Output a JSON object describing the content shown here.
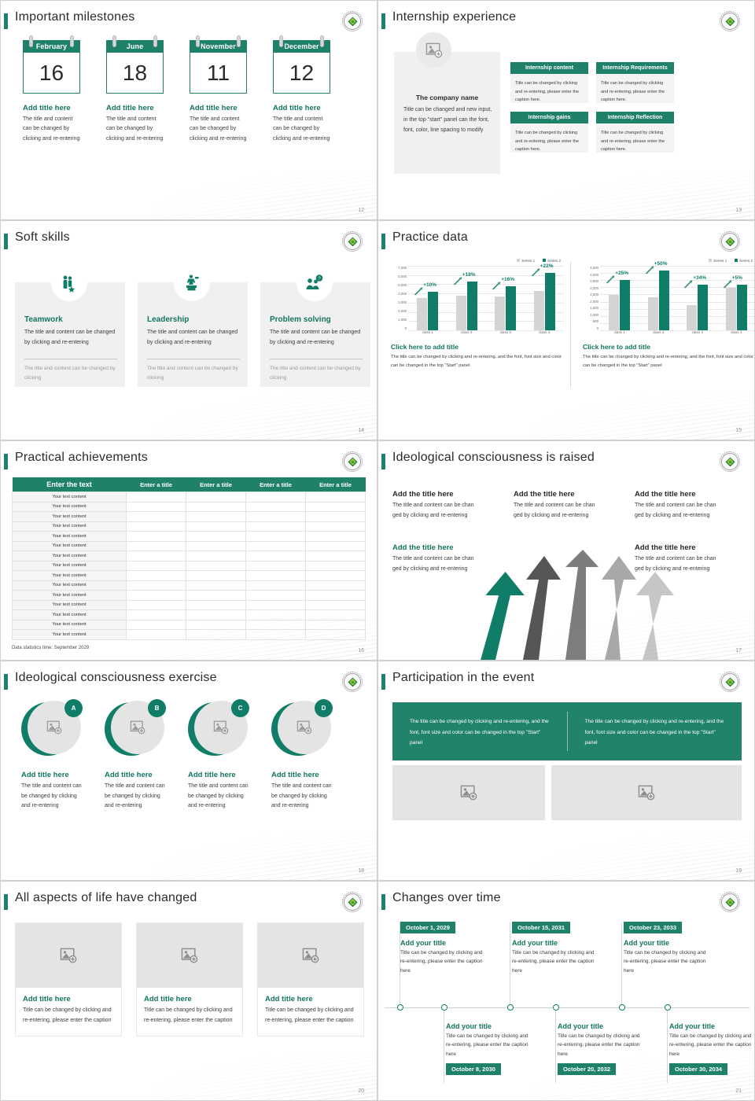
{
  "theme": {
    "green": "#1f8169",
    "green_dark": "#0f7d67",
    "green_text": "#13755f",
    "gray": "#d4d4d4"
  },
  "slides": [
    {
      "id": "important-milestones",
      "title": "Important milestones",
      "page": "12",
      "items": [
        {
          "month": "February",
          "day": "16",
          "title": "Add title here",
          "text": "The title and content can be changed by clicking and re-entering"
        },
        {
          "month": "June",
          "day": "18",
          "title": "Add title here",
          "text": "The title and content can be changed by clicking and re-entering"
        },
        {
          "month": "November",
          "day": "11",
          "title": "Add title here",
          "text": "The title and content can be changed by clicking and re-entering"
        },
        {
          "month": "December",
          "day": "12",
          "title": "Add title here",
          "text": "The title and content can be changed by clicking and re-entering"
        }
      ]
    },
    {
      "id": "internship-experience",
      "title": "Internship experience",
      "page": "13",
      "company": {
        "icon": "image-placeholder-icon",
        "name": "The company name",
        "text": "Title can be changed and new input, in the top \"start\" panel can the font, font, color, line spacing to modify"
      },
      "cards": [
        {
          "head": "Internship content",
          "body": "Title can be changed by clicking and re-entering, please enter the caption here."
        },
        {
          "head": "Internship Requirements",
          "body": "Title can be changed by clicking and re-entering, please enter the caption here."
        },
        {
          "head": "Internship gains",
          "body": "Title can be changed by clicking and re-entering, please enter the caption here."
        },
        {
          "head": "Internship Reflection",
          "body": "Title can be changed by clicking and re-entering, please enter the caption here."
        }
      ]
    },
    {
      "id": "soft-skills",
      "title": "Soft skills",
      "page": "14",
      "items": [
        {
          "icon": "teamwork-icon",
          "title": "Teamwork",
          "text": "The title and content can be changed by clicking and re-entering",
          "sub": "The title and content can be changed by clicking"
        },
        {
          "icon": "leadership-icon",
          "title": "Leadership",
          "text": "The title and content can be changed by clicking and re-entering",
          "sub": "The title and content can be changed by clicking"
        },
        {
          "icon": "problem-solving-icon",
          "title": "Problem solving",
          "text": "The title and content can be changed by clicking and re-entering",
          "sub": "The title and content can be changed by clicking"
        }
      ]
    },
    {
      "id": "practice-data",
      "title": "Practice data",
      "page": "15",
      "captions": [
        {
          "title": "Click here to add title",
          "text": "The title can be changed by clicking and re-entering, and the font, font size and color can be changed in the top \"Start\" panel"
        },
        {
          "title": "Click here to add title",
          "text": "The title can be changed by clicking and re-entering, and the font, font size and color can be changed in the top \"Start\" panel"
        }
      ]
    },
    {
      "id": "practical-achievements",
      "title": "Practical achievements",
      "page": "16",
      "table": {
        "headers": [
          "Enter the text",
          "Enter a title",
          "Enter a title",
          "Enter a title",
          "Enter a title"
        ],
        "first_col_value": "Your text content",
        "row_count": 15
      },
      "footer": "Data statistics time: September 2029"
    },
    {
      "id": "ideological-consciousness-is-raised",
      "title": "Ideological consciousness is raised",
      "page": "17",
      "blocks": [
        {
          "title": "Add the title here",
          "text": "The title and content can be chan ged by clicking and re-entering",
          "accent": false
        },
        {
          "title": "Add the title here",
          "text": "The title and content can be chan ged by clicking and re-entering",
          "accent": false
        },
        {
          "title": "Add the title here",
          "text": "The title and content can be chan ged by clicking and re-entering",
          "accent": false
        },
        {
          "title": "Add the title here",
          "text": "The title and content can be chan ged by clicking and re-entering",
          "accent": true
        },
        {
          "title": "Add the title here",
          "text": "The title and content can be chan ged by clicking and re-entering",
          "accent": false
        }
      ]
    },
    {
      "id": "ideological-consciousness-exercise",
      "title": "Ideological consciousness exercise",
      "page": "18",
      "items": [
        {
          "badge": "A",
          "icon": "image-placeholder-icon",
          "title": "Add title here",
          "text": "The title and content can be changed by clicking and re-entering"
        },
        {
          "badge": "B",
          "icon": "image-placeholder-icon",
          "title": "Add title here",
          "text": "The title and content can be changed by clicking and re-entering"
        },
        {
          "badge": "C",
          "icon": "image-placeholder-icon",
          "title": "Add title here",
          "text": "The title and content can be changed by clicking and re-entering"
        },
        {
          "badge": "D",
          "icon": "image-placeholder-icon",
          "title": "Add title here",
          "text": "The title and content can be changed by clicking and re-entering"
        }
      ]
    },
    {
      "id": "participation-in-the-event",
      "title": "Participation in the event",
      "page": "19",
      "texts": [
        "The title can be changed by clicking and re-entering, and the font, font size and color can be changed in the top \"Start\" panel",
        "The title can be changed by clicking and re-entering, and the font, font size and color can be changed in the top \"Start\" panel"
      ],
      "images": [
        "image-placeholder-icon",
        "image-placeholder-icon"
      ]
    },
    {
      "id": "all-aspects-of-life-have-changed",
      "title": "All aspects of life have changed",
      "page": "20",
      "items": [
        {
          "icon": "image-placeholder-icon",
          "title": "Add title here",
          "text": "Title can be changed by clicking and re-entering, please enter the caption"
        },
        {
          "icon": "image-placeholder-icon",
          "title": "Add title here",
          "text": "Title can be changed by clicking and re-entering, please enter the caption"
        },
        {
          "icon": "image-placeholder-icon",
          "title": "Add title here",
          "text": "Title can be changed by clicking and re-entering, please enter the caption"
        }
      ]
    },
    {
      "id": "changes-over-time",
      "title": "Changes over time",
      "page": "21",
      "timeline_top": [
        {
          "date": "October 1, 2029",
          "title": "Add your title",
          "text": "Title can be changed by clicking and re-entering, please enter the caption here"
        },
        {
          "date": "October 15, 2031",
          "title": "Add your title",
          "text": "Title can be changed by clicking and re-entering, please enter the caption here"
        },
        {
          "date": "October 23, 2033",
          "title": "Add your title",
          "text": "Title can be changed by clicking and re-entering, please enter the caption here"
        }
      ],
      "timeline_bottom": [
        {
          "date": "October 8, 2030",
          "title": "Add your title",
          "text": "Title can be changed by clicking and re-entering, please enter the caption here"
        },
        {
          "date": "October 20, 2032",
          "title": "Add your title",
          "text": "Title can be changed by clicking and re-entering, please enter the caption here"
        },
        {
          "date": "October 30, 2034",
          "title": "Add your title",
          "text": "Title can be changed by clicking and re-entering, please enter the caption here"
        }
      ]
    }
  ],
  "chart_data": [
    {
      "type": "bar",
      "title": "",
      "categories": [
        "class 1",
        "class 2",
        "class 3",
        "class 4"
      ],
      "series": [
        {
          "name": "Series 1",
          "values": [
            3500,
            3800,
            3700,
            4300
          ],
          "color": "#d4d4d4"
        },
        {
          "name": "Series 2",
          "values": [
            4200,
            5300,
            4800,
            6200
          ],
          "color": "#0f7d67"
        }
      ],
      "annotations": [
        "+10%",
        "+18%",
        "+16%",
        "+22%"
      ],
      "yticks": [
        "7,000",
        "6,000",
        "5,000",
        "4,000",
        "3,000",
        "2,000",
        "1,000",
        "0"
      ],
      "ylim": [
        0,
        7000
      ],
      "xlabel": "",
      "ylabel": "",
      "grid": true,
      "legend": "top-right"
    },
    {
      "type": "bar",
      "title": "",
      "categories": [
        "class 1",
        "class 2",
        "class 3",
        "class 4"
      ],
      "series": [
        {
          "name": "Series 1",
          "values": [
            2480,
            2300,
            1750,
            2950
          ],
          "color": "#d4d4d4"
        },
        {
          "name": "Series 2",
          "values": [
            3500,
            4150,
            3200,
            3200
          ],
          "color": "#0f7d67"
        }
      ],
      "annotations": [
        "+25%",
        "+50%",
        "+34%",
        "+5%"
      ],
      "yticks": [
        "4,500",
        "4,000",
        "3,500",
        "3,000",
        "2,500",
        "2,000",
        "1,500",
        "1,000",
        "500",
        "0"
      ],
      "ylim": [
        0,
        4500
      ],
      "xlabel": "",
      "ylabel": "",
      "grid": true,
      "legend": "top-right"
    }
  ]
}
